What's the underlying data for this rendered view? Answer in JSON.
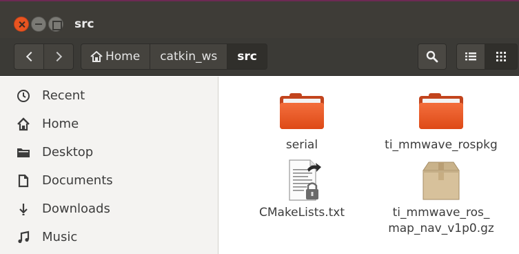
{
  "window": {
    "title": "src",
    "controls": [
      "close-icon",
      "minimize-icon",
      "maximize-icon"
    ]
  },
  "toolbar": {
    "back_icon": "chevron-left-icon",
    "forward_icon": "chevron-right-icon",
    "breadcrumbs": [
      "Home",
      "catkin_ws",
      "src"
    ],
    "search_icon": "search-icon",
    "list_view_icon": "list-view-icon",
    "grid_view_icon": "grid-view-icon"
  },
  "sidebar": {
    "items": [
      {
        "label": "Recent",
        "icon": "clock-icon"
      },
      {
        "label": "Home",
        "icon": "home-icon"
      },
      {
        "label": "Desktop",
        "icon": "folder-icon"
      },
      {
        "label": "Documents",
        "icon": "document-icon"
      },
      {
        "label": "Downloads",
        "icon": "download-icon"
      },
      {
        "label": "Music",
        "icon": "music-icon"
      }
    ]
  },
  "files": [
    {
      "name": "serial",
      "type": "folder",
      "icon": "folder-icon"
    },
    {
      "name": "ti_mmwave_rospkg",
      "type": "folder",
      "icon": "folder-icon"
    },
    {
      "name": "CMakeLists.txt",
      "type": "text-file-locked-link",
      "icon": "text-file-icon"
    },
    {
      "name_lines": [
        "ti_mmwave_ros_",
        "map_nav_v1p0.gz"
      ],
      "type": "archive",
      "icon": "archive-icon"
    }
  ],
  "colors": {
    "accent": "#e95420",
    "titlebar": "#3e3c37",
    "sidebar_bg": "#f4f3f1",
    "folder": "#f06a37"
  }
}
